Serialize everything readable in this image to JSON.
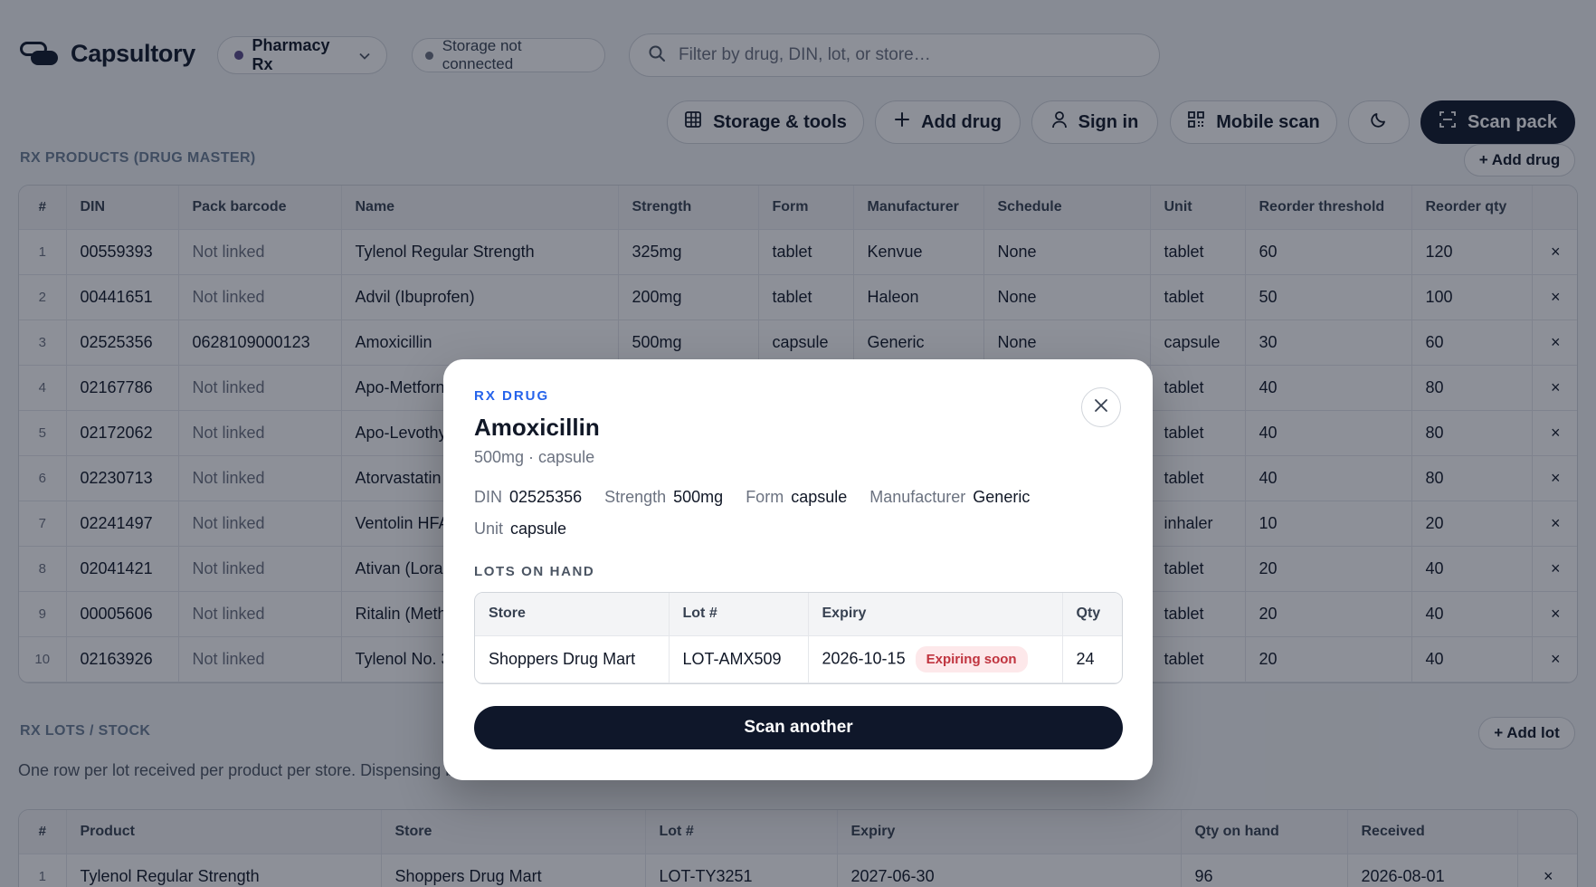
{
  "app": {
    "title": "Capsultory",
    "workspace": "Pharmacy Rx",
    "storage_status": "Storage not connected",
    "search_placeholder": "Filter by drug, DIN, lot, or store…"
  },
  "toolbar": {
    "storage_tools": "Storage & tools",
    "add_drug": "Add drug",
    "sign_in": "Sign in",
    "mobile_scan": "Mobile scan",
    "scan_pack": "Scan pack"
  },
  "products": {
    "title": "RX PRODUCTS (DRUG MASTER)",
    "add_button": "+ Add drug",
    "columns": [
      "#",
      "DIN",
      "Pack barcode",
      "Name",
      "Strength",
      "Form",
      "Manufacturer",
      "Schedule",
      "Unit",
      "Reorder threshold",
      "Reorder qty",
      ""
    ],
    "delete_glyph": "×",
    "rows": [
      {
        "n": "1",
        "din": "00559393",
        "barcode": "Not linked",
        "name": "Tylenol Regular Strength",
        "strength": "325mg",
        "form": "tablet",
        "manufacturer": "Kenvue",
        "schedule": "None",
        "unit": "tablet",
        "threshold": "60",
        "qty": "120"
      },
      {
        "n": "2",
        "din": "00441651",
        "barcode": "Not linked",
        "name": "Advil (Ibuprofen)",
        "strength": "200mg",
        "form": "tablet",
        "manufacturer": "Haleon",
        "schedule": "None",
        "unit": "tablet",
        "threshold": "50",
        "qty": "100"
      },
      {
        "n": "3",
        "din": "02525356",
        "barcode": "0628109000123",
        "name": "Amoxicillin",
        "strength": "500mg",
        "form": "capsule",
        "manufacturer": "Generic",
        "schedule": "None",
        "unit": "capsule",
        "threshold": "30",
        "qty": "60"
      },
      {
        "n": "4",
        "din": "02167786",
        "barcode": "Not linked",
        "name": "Apo-Metforn",
        "strength": "",
        "form": "",
        "manufacturer": "",
        "schedule": "",
        "unit": "tablet",
        "threshold": "40",
        "qty": "80"
      },
      {
        "n": "5",
        "din": "02172062",
        "barcode": "Not linked",
        "name": "Apo-Levothy",
        "strength": "",
        "form": "",
        "manufacturer": "",
        "schedule": "",
        "unit": "tablet",
        "threshold": "40",
        "qty": "80"
      },
      {
        "n": "6",
        "din": "02230713",
        "barcode": "Not linked",
        "name": "Atorvastatin",
        "strength": "",
        "form": "",
        "manufacturer": "",
        "schedule": "",
        "unit": "tablet",
        "threshold": "40",
        "qty": "80"
      },
      {
        "n": "7",
        "din": "02241497",
        "barcode": "Not linked",
        "name": "Ventolin HFA",
        "strength": "",
        "form": "",
        "manufacturer": "",
        "schedule": "",
        "unit": "inhaler",
        "threshold": "10",
        "qty": "20"
      },
      {
        "n": "8",
        "din": "02041421",
        "barcode": "Not linked",
        "name": "Ativan (Lora",
        "strength": "",
        "form": "",
        "manufacturer": "",
        "schedule": "",
        "unit": "tablet",
        "threshold": "20",
        "qty": "40"
      },
      {
        "n": "9",
        "din": "00005606",
        "barcode": "Not linked",
        "name": "Ritalin (Meth",
        "strength": "",
        "form": "",
        "manufacturer": "",
        "schedule": "",
        "unit": "tablet",
        "threshold": "20",
        "qty": "40"
      },
      {
        "n": "10",
        "din": "02163926",
        "barcode": "Not linked",
        "name": "Tylenol No. 3",
        "strength": "",
        "form": "",
        "manufacturer": "",
        "schedule": "",
        "unit": "tablet",
        "threshold": "20",
        "qty": "40"
      }
    ]
  },
  "lots": {
    "title": "RX LOTS / STOCK",
    "add_button": "+ Add lot",
    "description": "One row per lot received per product per store. Dispensing be",
    "columns": [
      "#",
      "Product",
      "Store",
      "Lot #",
      "Expiry",
      "Qty on hand",
      "Received",
      ""
    ],
    "rows": [
      {
        "n": "1",
        "product": "Tylenol Regular Strength",
        "store": "Shoppers Drug Mart",
        "lot": "LOT-TY3251",
        "expiry": "2027-06-30",
        "qty": "96",
        "received": "2026-08-01"
      }
    ]
  },
  "modal": {
    "eyebrow": "RX DRUG",
    "title": "Amoxicillin",
    "subtitle": "500mg · capsule",
    "fields": [
      {
        "label": "DIN",
        "value": "02525356"
      },
      {
        "label": "Strength",
        "value": "500mg"
      },
      {
        "label": "Form",
        "value": "capsule"
      },
      {
        "label": "Manufacturer",
        "value": "Generic"
      },
      {
        "label": "Unit",
        "value": "capsule"
      }
    ],
    "lots_title": "LOTS ON HAND",
    "lots_columns": [
      "Store",
      "Lot #",
      "Expiry",
      "Qty"
    ],
    "lots_rows": [
      {
        "store": "Shoppers Drug Mart",
        "lot": "LOT-AMX509",
        "expiry": "2026-10-15",
        "badge": "Expiring soon",
        "qty": "24"
      }
    ],
    "primary_button": "Scan another"
  },
  "icons": {
    "storage": "grid-icon",
    "add": "plus-icon",
    "sign_in": "user-icon",
    "mobile_scan": "qr-icon",
    "theme": "moon-icon",
    "scan_pack": "scan-icon",
    "search": "search-icon",
    "close": "close-icon"
  },
  "colors": {
    "primary": "#0f172a",
    "accent": "#2563eb",
    "badge_text": "#c0343f",
    "badge_bg": "#fde8ea"
  }
}
